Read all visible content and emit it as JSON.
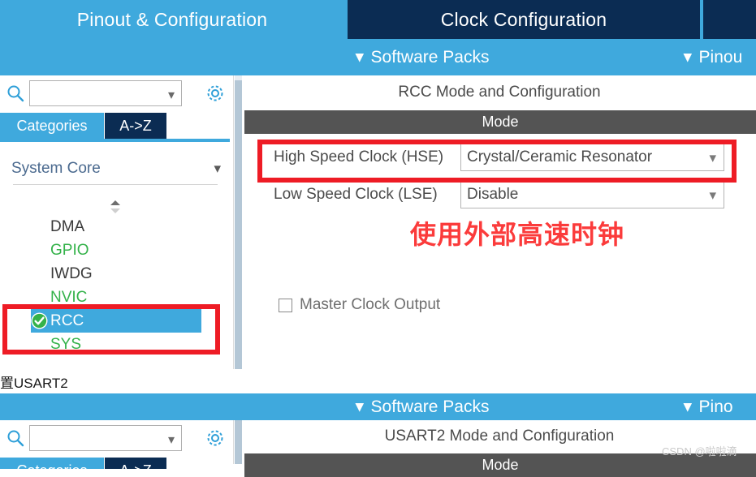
{
  "panel1": {
    "tabs": [
      {
        "label": "Pinout & Configuration",
        "active": false
      },
      {
        "label": "Clock Configuration",
        "active": true
      },
      {
        "label": "",
        "active": true
      }
    ],
    "subbar": {
      "software_packs": "Software Packs",
      "pinout_partial": "Pinou",
      "chevron": "⌄"
    },
    "sidebar": {
      "search_placeholder": "",
      "search_value": "",
      "search_icon": "search-icon",
      "gear_icon": "gear-icon",
      "category_tabs": [
        {
          "label": "Categories",
          "active": true
        },
        {
          "label": "A->Z",
          "active": false
        }
      ],
      "group": {
        "name": "System Core",
        "chevron": "⌄"
      },
      "items": [
        {
          "label": "DMA",
          "state": "normal"
        },
        {
          "label": "GPIO",
          "state": "configured"
        },
        {
          "label": "IWDG",
          "state": "normal"
        },
        {
          "label": "NVIC",
          "state": "configured"
        },
        {
          "label": "RCC",
          "state": "selected"
        },
        {
          "label": "SYS",
          "state": "configured"
        }
      ]
    },
    "config": {
      "title": "RCC Mode and Configuration",
      "mode_header": "Mode",
      "rows": [
        {
          "label": "High Speed Clock (HSE)",
          "value": "Crystal/Ceramic Resonator"
        },
        {
          "label": "Low Speed Clock (LSE)",
          "value": "Disable"
        }
      ],
      "checkbox": {
        "label": "Master Clock Output",
        "checked": false
      }
    },
    "annotation": "使用外部高速时钟"
  },
  "caption": "置USART2",
  "panel2": {
    "subbar": {
      "software_packs": "Software Packs",
      "pinout_partial": "Pino",
      "chevron": "⌄"
    },
    "sidebar": {
      "search_value": "",
      "search_icon": "search-icon",
      "gear_icon": "gear-icon",
      "category_tabs": [
        {
          "label": "Categories",
          "active": true
        },
        {
          "label": "A->Z",
          "active": false
        }
      ]
    },
    "config": {
      "title": "USART2 Mode and Configuration",
      "mode_header": "Mode"
    }
  },
  "watermark": "CSDN @啦啦滴",
  "colors": {
    "brand_blue": "#3fa9dd",
    "navy": "#0b2c53",
    "annotation_red": "#ee1c25",
    "mode_gray": "#545454",
    "configured_green": "#34b24a"
  }
}
